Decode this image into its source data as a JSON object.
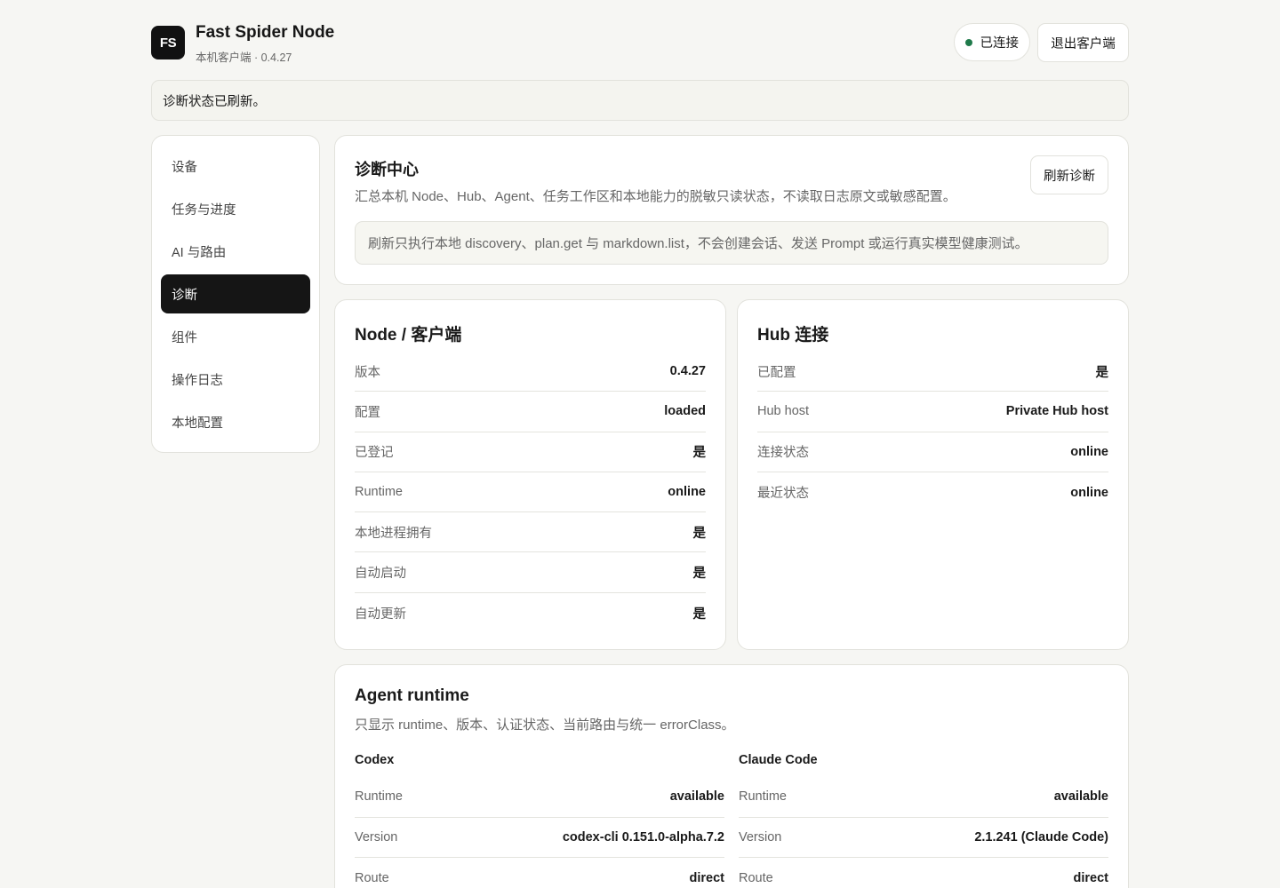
{
  "header": {
    "logo": "FS",
    "title": "Fast Spider Node",
    "subtitle": "本机客户端 · 0.4.27",
    "status_label": "已连接",
    "status_color": "#1f7a4a",
    "exit_label": "退出客户端"
  },
  "notice": "诊断状态已刷新。",
  "sidebar": {
    "items": [
      {
        "label": "设备"
      },
      {
        "label": "任务与进度"
      },
      {
        "label": "AI 与路由"
      },
      {
        "label": "诊断"
      },
      {
        "label": "组件"
      },
      {
        "label": "操作日志"
      },
      {
        "label": "本地配置"
      }
    ],
    "active": "诊断"
  },
  "diagnostics": {
    "title": "诊断中心",
    "description": "汇总本机 Node、Hub、Agent、任务工作区和本地能力的脱敏只读状态，不读取日志原文或敏感配置。",
    "refresh_label": "刷新诊断",
    "note": "刷新只执行本地 discovery、plan.get 与 markdown.list，不会创建会话、发送 Prompt 或运行真实模型健康测试。"
  },
  "node": {
    "title": "Node / 客户端",
    "rows": [
      {
        "key": "版本",
        "value": "0.4.27"
      },
      {
        "key": "配置",
        "value": "loaded"
      },
      {
        "key": "已登记",
        "value": "是"
      },
      {
        "key": "Runtime",
        "value": "online"
      },
      {
        "key": "本地进程拥有",
        "value": "是"
      },
      {
        "key": "自动启动",
        "value": "是"
      },
      {
        "key": "自动更新",
        "value": "是"
      }
    ]
  },
  "hub": {
    "title": "Hub 连接",
    "rows": [
      {
        "key": "已配置",
        "value": "是"
      },
      {
        "key": "Hub host",
        "value": "Private Hub host"
      },
      {
        "key": "连接状态",
        "value": "online"
      },
      {
        "key": "最近状态",
        "value": "online"
      }
    ]
  },
  "agent": {
    "title": "Agent runtime",
    "description": "只显示 runtime、版本、认证状态、当前路由与统一 errorClass。",
    "agents": [
      {
        "name": "Codex",
        "rows": [
          {
            "key": "Runtime",
            "value": "available"
          },
          {
            "key": "Version",
            "value": "codex-cli 0.151.0-alpha.7.2"
          },
          {
            "key": "Route",
            "value": "direct"
          }
        ]
      },
      {
        "name": "Claude Code",
        "rows": [
          {
            "key": "Runtime",
            "value": "available"
          },
          {
            "key": "Version",
            "value": "2.1.241 (Claude Code)"
          },
          {
            "key": "Route",
            "value": "direct"
          }
        ]
      }
    ]
  }
}
